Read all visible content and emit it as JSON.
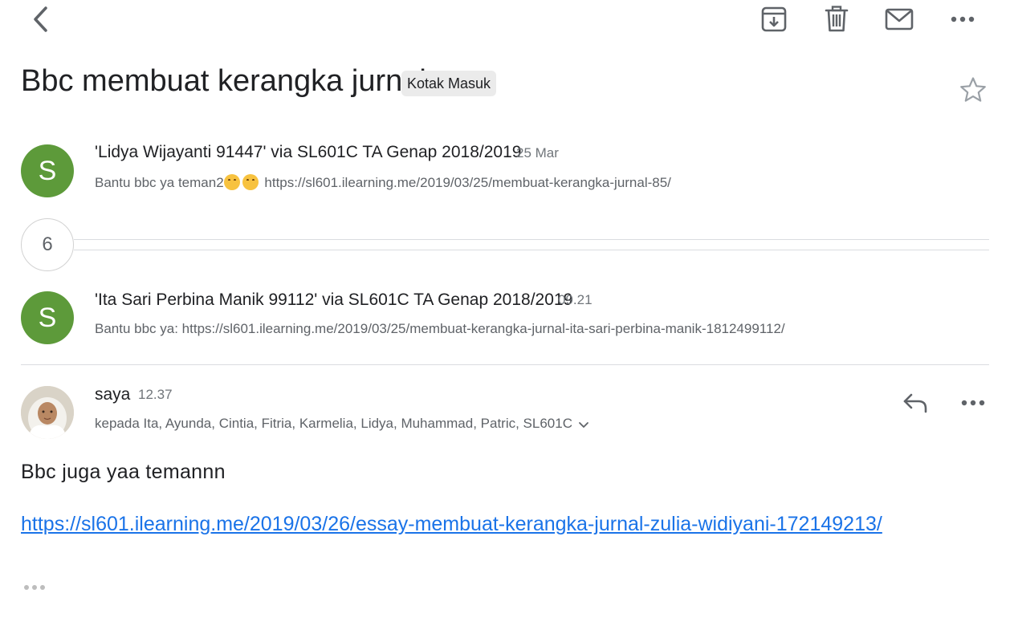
{
  "toolbar": {
    "back_icon": "chevron-left-icon",
    "archive_icon": "archive-icon",
    "delete_icon": "trash-icon",
    "mark_unread_icon": "mail-icon",
    "more_icon": "more-horizontal-icon"
  },
  "thread": {
    "subject": "Bbc membuat kerangka jurnal",
    "label": "Kotak Masuk",
    "star_icon": "star-outline-icon",
    "collapsed_count": "6"
  },
  "messages": [
    {
      "avatar_letter": "S",
      "avatar_color": "#5d9a3a",
      "sender": "'Lidya Wijayanti 91447' via SL601C TA Genap 2018/2019",
      "time": "25 Mar",
      "snippet_prefix": "Bantu bbc ya teman2",
      "snippet_suffix": " https://sl601.ilearning.me/2019/03/25/membuat-kerangka-jurnal-85/",
      "emoji_icon": "smiling-face-emoji-icon"
    },
    {
      "avatar_letter": "S",
      "avatar_color": "#5d9a3a",
      "sender": "'Ita Sari Perbina Manik 99112' via SL601C TA Genap 2018/2019",
      "time": "09.21",
      "snippet": "Bantu bbc ya: https://sl601.ilearning.me/2019/03/25/membuat-kerangka-jurnal-ita-sari-perbina-manik-1812499112/"
    },
    {
      "sender": "saya",
      "time": "12.37",
      "recipients": "kepada Ita, Ayunda, Cintia, Fitria, Karmelia, Lidya, Muhammad, Patric, SL601C",
      "reply_icon": "reply-icon",
      "more_icon": "more-horizontal-icon",
      "body_text": "Bbc juga yaa temannn",
      "body_link": "https://sl601.ilearning.me/2019/03/26/essay-membuat-kerangka-jurnal-zulia-widiyani-172149213/",
      "show_trimmed_icon": "ellipsis-icon"
    }
  ],
  "colors": {
    "accent_link": "#1a73e8",
    "avatar_green": "#5d9a3a"
  }
}
